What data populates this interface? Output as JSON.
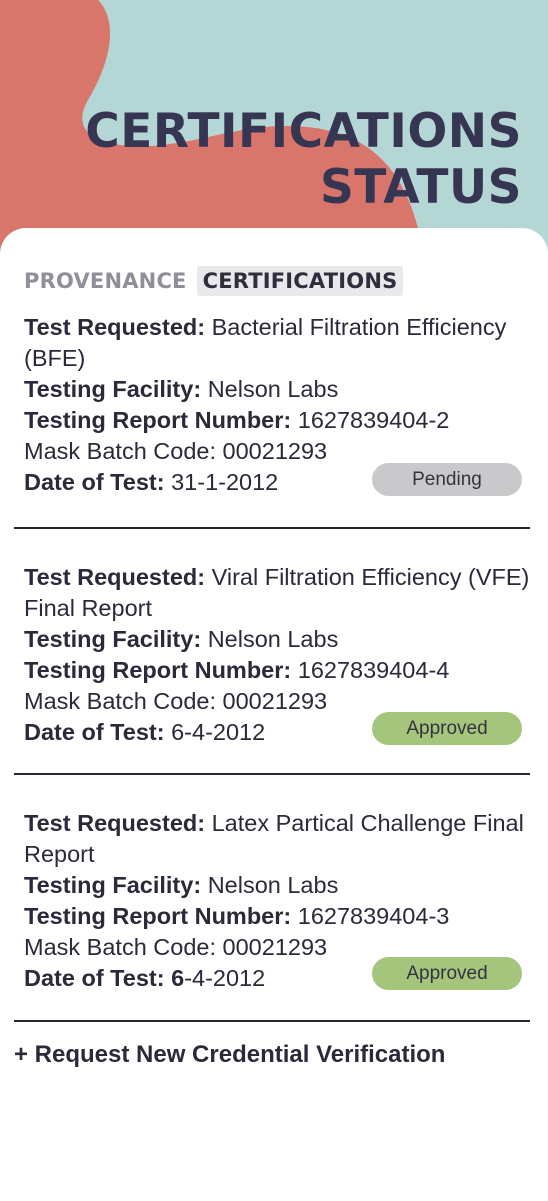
{
  "header": {
    "title_line1": "CERTIFICATIONS",
    "title_line2": "STATUS"
  },
  "tabs": [
    {
      "label": "PROVENANCE",
      "active": false
    },
    {
      "label": "CERTIFICATIONS",
      "active": true
    }
  ],
  "labels": {
    "test_requested": "Test Requested:",
    "testing_facility": "Testing Facility:",
    "report_number": "Testing Report Number:",
    "batch_code": "Mask Batch Code:",
    "date_of_test": "Date of Test:"
  },
  "entries": [
    {
      "test": "Bacterial Filtration Efficiency (BFE)",
      "facility": "Nelson Labs",
      "report_number": "1627839404-2",
      "batch_code": "00021293",
      "date": "31-1-2012",
      "status": "Pending"
    },
    {
      "test": "Viral Filtration Efficiency (VFE) Final Report",
      "facility": "Nelson Labs",
      "report_number": "1627839404-4",
      "batch_code": "00021293",
      "date": "6-4-2012",
      "status": "Approved"
    },
    {
      "test": "Latex Partical Challenge Final Report",
      "facility": "Nelson Labs",
      "report_number": "1627839404-3",
      "batch_code": "00021293",
      "date_bold_prefix": "6",
      "date_rest": "-4-2012",
      "status": "Approved"
    }
  ],
  "actions": {
    "request_label": "+ Request New Credential Verification"
  },
  "colors": {
    "hero_teal": "#b4d7d6",
    "hero_coral": "#d8766c",
    "title": "#363653",
    "pending": "#c9c9cc",
    "approved": "#a5c57d"
  }
}
